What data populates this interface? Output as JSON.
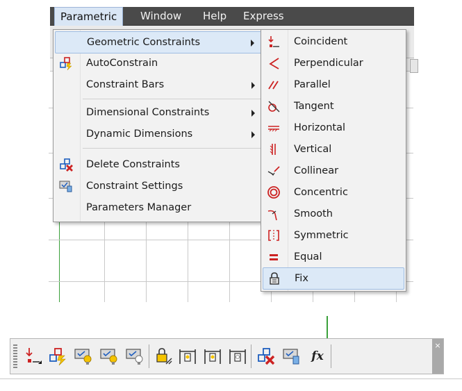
{
  "menubar": {
    "items": [
      {
        "label": "Parametric",
        "active": true
      },
      {
        "label": "Window"
      },
      {
        "label": "Help"
      },
      {
        "label": "Express"
      }
    ]
  },
  "parametric_menu": {
    "items": [
      {
        "label": "Geometric Constraints",
        "icon": "none",
        "submenu": true,
        "highlighted": true
      },
      {
        "label": "AutoConstrain",
        "icon": "autoconstrain-icon"
      },
      {
        "label": "Constraint Bars",
        "icon": "none",
        "submenu": true
      },
      {
        "label": "Dimensional Constraints",
        "icon": "none",
        "submenu": true
      },
      {
        "label": "Dynamic Dimensions",
        "icon": "none",
        "submenu": true
      },
      {
        "label": "Delete Constraints",
        "icon": "delete-constraints-icon"
      },
      {
        "label": "Constraint Settings",
        "icon": "constraint-settings-icon"
      },
      {
        "label": "Parameters Manager",
        "icon": "none"
      }
    ]
  },
  "geometric_submenu": {
    "items": [
      {
        "label": "Coincident",
        "icon": "coincident-icon"
      },
      {
        "label": "Perpendicular",
        "icon": "perpendicular-icon"
      },
      {
        "label": "Parallel",
        "icon": "parallel-icon"
      },
      {
        "label": "Tangent",
        "icon": "tangent-icon"
      },
      {
        "label": "Horizontal",
        "icon": "horizontal-icon"
      },
      {
        "label": "Vertical",
        "icon": "vertical-icon"
      },
      {
        "label": "Collinear",
        "icon": "collinear-icon"
      },
      {
        "label": "Concentric",
        "icon": "concentric-icon"
      },
      {
        "label": "Smooth",
        "icon": "smooth-icon"
      },
      {
        "label": "Symmetric",
        "icon": "symmetric-icon"
      },
      {
        "label": "Equal",
        "icon": "equal-icon"
      },
      {
        "label": "Fix",
        "icon": "fix-icon",
        "highlighted": true
      }
    ]
  },
  "toolbar": {
    "buttons": [
      "coincident-icon",
      "autoconstrain-icon",
      "show-constraints-icon",
      "show-all-constraints-icon",
      "hide-all-constraints-icon",
      "dimensional-lock-icon",
      "linear-dimension-icon",
      "aligned-dimension-icon",
      "vertical-dimension-icon",
      "delete-constraints-icon",
      "constraint-settings-icon",
      "parameters-manager-icon"
    ],
    "fx_label": "fx",
    "close_label": "×"
  },
  "colors": {
    "menubar_bg": "#4a4a4a",
    "menu_bg": "#f2f2f2",
    "highlight_bg": "#dce9f7",
    "highlight_border": "#9fbde2",
    "icon_red": "#cc2222",
    "icon_blue": "#1f5fbf",
    "icon_yellow": "#f5c400",
    "grid_green": "#33aa33"
  }
}
